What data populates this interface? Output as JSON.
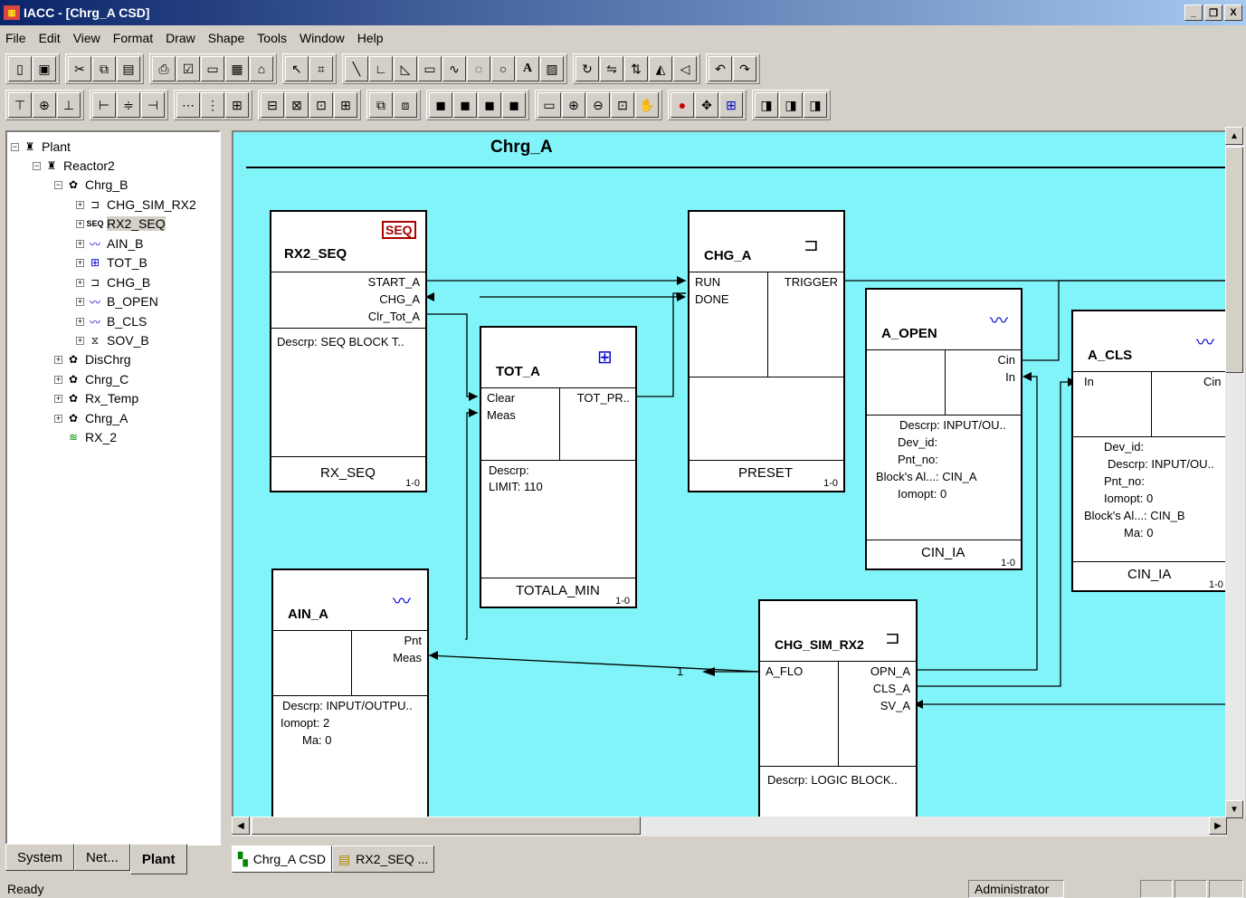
{
  "window": {
    "title": "IACC - [Chrg_A CSD]",
    "app_icon": "iacc-icon",
    "controls": {
      "minimize": "_",
      "restore": "❐",
      "close": "X"
    }
  },
  "menu": [
    "File",
    "Edit",
    "View",
    "Format",
    "Draw",
    "Shape",
    "Tools",
    "Window",
    "Help"
  ],
  "tree": {
    "items": [
      {
        "label": "Plant",
        "icon": "plant-icon"
      },
      {
        "label": "Reactor2",
        "icon": "reactor-icon"
      },
      {
        "label": "Chrg_B",
        "icon": "loop-icon"
      },
      {
        "label": "CHG_SIM_RX2",
        "icon": "logic-block-icon"
      },
      {
        "label": "RX2_SEQ",
        "icon": "seq-block-icon"
      },
      {
        "label": "AIN_B",
        "icon": "analog-input-icon"
      },
      {
        "label": "TOT_B",
        "icon": "totalizer-icon"
      },
      {
        "label": "CHG_B",
        "icon": "logic-block-icon"
      },
      {
        "label": "B_OPEN",
        "icon": "analog-input-icon"
      },
      {
        "label": "B_CLS",
        "icon": "analog-input-icon"
      },
      {
        "label": "SOV_B",
        "icon": "valve-icon"
      },
      {
        "label": "DisChrg",
        "icon": "loop-icon"
      },
      {
        "label": "Chrg_C",
        "icon": "loop-icon"
      },
      {
        "label": "Rx_Temp",
        "icon": "loop-icon"
      },
      {
        "label": "Chrg_A",
        "icon": "loop-icon"
      },
      {
        "label": "RX_2",
        "icon": "layers-icon"
      }
    ]
  },
  "left_tabs": [
    "System",
    "Net...",
    "Plant"
  ],
  "doc_tabs": [
    "Chrg_A CSD",
    "RX2_SEQ ..."
  ],
  "diagram": {
    "title": "Chrg_A",
    "const_value": "1",
    "blocks": {
      "rx2_seq": {
        "name": "RX2_SEQ",
        "outputs": [
          "START_A",
          "CHG_A",
          "Clr_Tot_A"
        ],
        "desc": "Descrp:  SEQ BLOCK T..",
        "footer": "RX_SEQ",
        "ver": "1-0"
      },
      "tot_a": {
        "name": "TOT_A",
        "inputs": [
          "Clear",
          "Meas"
        ],
        "outputs": [
          "TOT_PR.."
        ],
        "desc": [
          "Descrp:",
          "LIMIT:  110"
        ],
        "footer": "TOTALA_MIN",
        "ver": "1-0"
      },
      "chg_a": {
        "name": "CHG_A",
        "inputs": [
          "RUN",
          "DONE"
        ],
        "outputs": [
          "TRIGGER"
        ],
        "footer": "PRESET",
        "ver": "1-0"
      },
      "a_open": {
        "name": "A_OPEN",
        "outputs": [
          "Cin",
          "In"
        ],
        "desc": [
          "Descrp:  INPUT/OU..",
          "Dev_id:",
          "Pnt_no:",
          "Block's Al...: CIN_A",
          "Iomopt:  0"
        ],
        "footer": "CIN_IA",
        "ver": "1-0"
      },
      "a_cls": {
        "name": "A_CLS",
        "inputs": [
          "In"
        ],
        "outputs": [
          "Cin"
        ],
        "desc": [
          "Dev_id:",
          "Descrp:  INPUT/OU..",
          "Pnt_no:",
          "Iomopt:  0",
          "Block's Al...: CIN_B",
          "Ma:  0"
        ],
        "footer": "CIN_IA",
        "ver": "1-0"
      },
      "ain_a": {
        "name": "AIN_A",
        "outputs": [
          "Pnt",
          "Meas"
        ],
        "desc": [
          "Descrp:  INPUT/OUTPU..",
          "Iomopt:  2",
          "Ma:  0"
        ]
      },
      "chg_sim": {
        "name": "CHG_SIM_RX2",
        "inputs": [
          "A_FLO"
        ],
        "outputs": [
          "OPN_A",
          "CLS_A",
          "SV_A"
        ],
        "desc": "Descrp:  LOGIC BLOCK.."
      }
    }
  },
  "status": {
    "text": "Ready",
    "user": "Administrator"
  }
}
